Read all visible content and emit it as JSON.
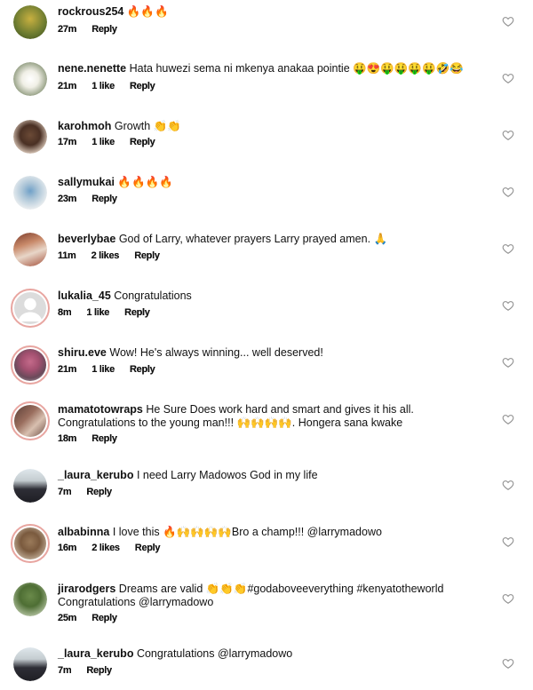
{
  "comments": [
    {
      "user": "rockrous254",
      "text": "🔥🔥🔥",
      "time": "27m",
      "likes": "",
      "reply": "Reply"
    },
    {
      "user": "nene.nenette",
      "text": "Hata huwezi sema ni mkenya anakaa pointie 🤑😍🤑🤑🤑🤑🤣😂",
      "time": "21m",
      "likes": "1 like",
      "reply": "Reply"
    },
    {
      "user": "karohmoh",
      "text": "Growth 👏👏",
      "time": "17m",
      "likes": "1 like",
      "reply": "Reply"
    },
    {
      "user": "sallymukai",
      "text": "🔥🔥🔥🔥",
      "time": "23m",
      "likes": "",
      "reply": "Reply"
    },
    {
      "user": "beverlybae",
      "text": "God of Larry, whatever prayers Larry prayed amen. 🙏",
      "time": "11m",
      "likes": "2 likes",
      "reply": "Reply"
    },
    {
      "user": "lukalia_45",
      "text": "Congratulations",
      "time": "8m",
      "likes": "1 like",
      "reply": "Reply"
    },
    {
      "user": "shiru.eve",
      "text": "Wow! He's always winning... well deserved!",
      "time": "21m",
      "likes": "1 like",
      "reply": "Reply"
    },
    {
      "user": "mamatotowraps",
      "text": "He Sure Does work hard and smart and gives it his all. Congratulations to the young man!!! 🙌🙌🙌🙌. Hongera sana kwake",
      "time": "18m",
      "likes": "",
      "reply": "Reply"
    },
    {
      "user": "_laura_kerubo",
      "text": "I need Larry Madowos God in my life",
      "time": "7m",
      "likes": "",
      "reply": "Reply"
    },
    {
      "user": "albabinna",
      "text": "I love this 🔥🙌🙌🙌🙌Bro a champ!!! @larrymadowo",
      "time": "16m",
      "likes": "2 likes",
      "reply": "Reply"
    },
    {
      "user": "jirarodgers",
      "text": "Dreams  are  valid 👏👏👏#godaboveeverything #kenyatotheworld Congratulations @larrymadowo",
      "time": "25m",
      "likes": "",
      "reply": "Reply"
    },
    {
      "user": "_laura_kerubo",
      "text": "Congratulations @larrymadowo",
      "time": "7m",
      "likes": "",
      "reply": "Reply"
    }
  ],
  "colors": {
    "ring": "#e8a5a0",
    "heart": "#8e8e8e"
  }
}
